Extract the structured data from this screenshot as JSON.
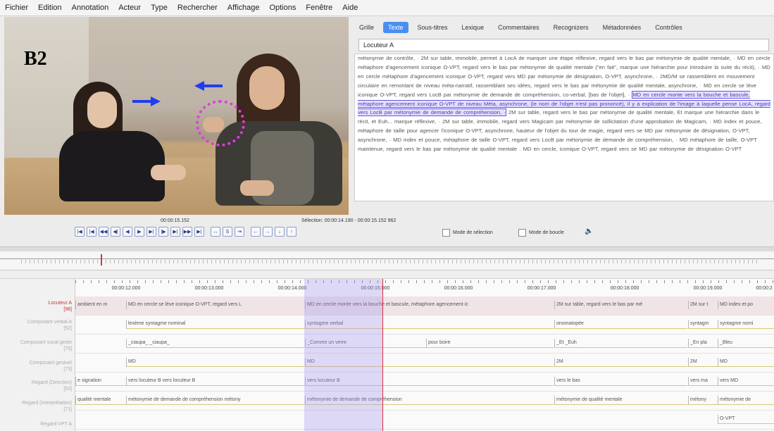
{
  "menu": [
    "Fichier",
    "Edition",
    "Annotation",
    "Acteur",
    "Type",
    "Rechercher",
    "Affichage",
    "Options",
    "Fenêtre",
    "Aide"
  ],
  "video": {
    "overlay_label": "B2",
    "arrow_color": "#1f3df0",
    "circle_color": "#e23be0"
  },
  "tabs": [
    "Grille",
    "Texte",
    "Sous-titres",
    "Lexique",
    "Commentaires",
    "Recognizers",
    "Métadonnées",
    "Contrôles"
  ],
  "active_tab": "Texte",
  "speaker_select": "Locuteur A",
  "text_panel": {
    "before": "métonymie de contrôle, · 2M sur table, immobile, permet à LocA de marquer une étape réflexive, regard vers le bas par métonymie de qualité mentale, · MD en cercle métaphore d'agencement iconique O-VPT, regard vers le bas par métonymie de qualité mentale (\"en fait\", marque une hiérarchie pour introduire la suite du récit), · MD en cercle métaphore d'agencement iconique O-VPT, regard vers MD par métonymie de désignation, O-VPT, asynchrone, · 2MD/M se rassemblent en mouvement circulaire en remontant de niveau méta-narratif, rassemblant ses idées, regard vers le bas par métonymie de qualité mentale, asynchrone, · MD en cercle se lève iconique O-VPT, regard vers LocB par métonymie de demande de compréhension, co-verbal, [bas de l'objet], · ",
    "highlight": "MD en cercle monte vers la bouche et bascule, métaphore agencement iconique O-VPT de niveau Méta, asynchrone, (le nom de l'objet n'est pas prononcé), il y a explication de l'image à laquelle pense LocA, regard vers LocB par métonymie de demande de compréhension, ·",
    "after": " 2M sur table, regard vers le bas par métonymie de qualité mentale, Et marque une hiérarchie dans le récit, et Euh... marque réflexive, · 2M sur table, immobile, regard vers Magicam par métonymie de sollicitation d'une approbation de Magicam, · MD index et pouce, métaphore de taille pour agencer l'iconique O-VPT, asynchrone, hauteur de l'objet du tour de magie, regard vers se MD par métonymie de désignation, O-VPT, asynchrone, · MD index et pouce, métaphore de taille O-VPT, regard vers LocB par métonymie de demande de compréhension, · MD métaphore de taille, O-VPT maintenue, regard vers le bas par métonymie de qualité mentale · MD en cercle, iconique O-VPT, regard vers se MD par métonymie de désignation O-VPT"
  },
  "controls": {
    "time": "00:00:15.152",
    "selection": "Sélection: 00:00:14.190 - 00:00:15.152  962",
    "buttons": [
      "|◀",
      "|◀",
      "◀◀",
      "◀|",
      "◀",
      "▶",
      "▶|",
      "|▶",
      "▶|",
      "▶▶",
      "▶|"
    ],
    "sel_buttons": [
      "↔",
      "S",
      "⇥"
    ],
    "nav_buttons": [
      "←",
      "→",
      "↓",
      "↑"
    ],
    "selection_mode": "Mode de sélection",
    "loop_mode": "Mode de boucle"
  },
  "ruler_ticks": [
    "00:00:12.000",
    "00:00:13.000",
    "00:00:14.000",
    "00:00:15.000",
    "00:00:16.000",
    "00:00:17.000",
    "00:00:18.000",
    "00:00:19.000",
    "00:00:2"
  ],
  "tiers": [
    {
      "label": "Locuteur A",
      "sub": "[98]",
      "red": true
    },
    {
      "label": "Composant verbal A",
      "sub": "[52]",
      "red": false
    },
    {
      "label": "Composant vocal geste",
      "sub": "[75]",
      "red": false
    },
    {
      "label": "Composant gestuel",
      "sub": "[73]",
      "red": false
    },
    {
      "label": "Regard (Direction)",
      "sub": "[53]",
      "red": false
    },
    {
      "label": "Regard (Interprétation)",
      "sub": "[71]",
      "red": false
    },
    {
      "label": "Regard VPT A",
      "sub": "",
      "red": false
    }
  ],
  "rows": [
    [
      "ambient en m",
      "MD en cercle se lève iconique O-VPT, regard vers L",
      "MD en cercle monte vers la bouche et bascule, métaphore agencement ic",
      "2M sur table, regard vers le bas par mé",
      "2M sur t",
      "MD index et po"
    ],
    [
      "",
      "lexème syntagme nominal",
      "syntagme verbal",
      "onomatopée",
      "syntagm",
      "syntagme nomi"
    ],
    [
      "",
      "_ciaupa_ _ciaupa_",
      "_Comme un verre",
      "pour   boire",
      "_Et   _Euh",
      "_En pla",
      "_Bleu"
    ],
    [
      "",
      "MD",
      "MD",
      "2M",
      "2M",
      "MD"
    ],
    [
      "e signation",
      "vers locuteur B vers locuteur B",
      "vers locuteur B",
      "vers le bas",
      "vers ma",
      "vers MD"
    ],
    [
      "qualité mentale",
      "métonymie de demande de compréhension   métony",
      "métonymie de demande de compréhension",
      "métonymie de qualité mentale",
      "métony",
      "métonymie de"
    ],
    [
      "",
      "O-VPT"
    ]
  ]
}
